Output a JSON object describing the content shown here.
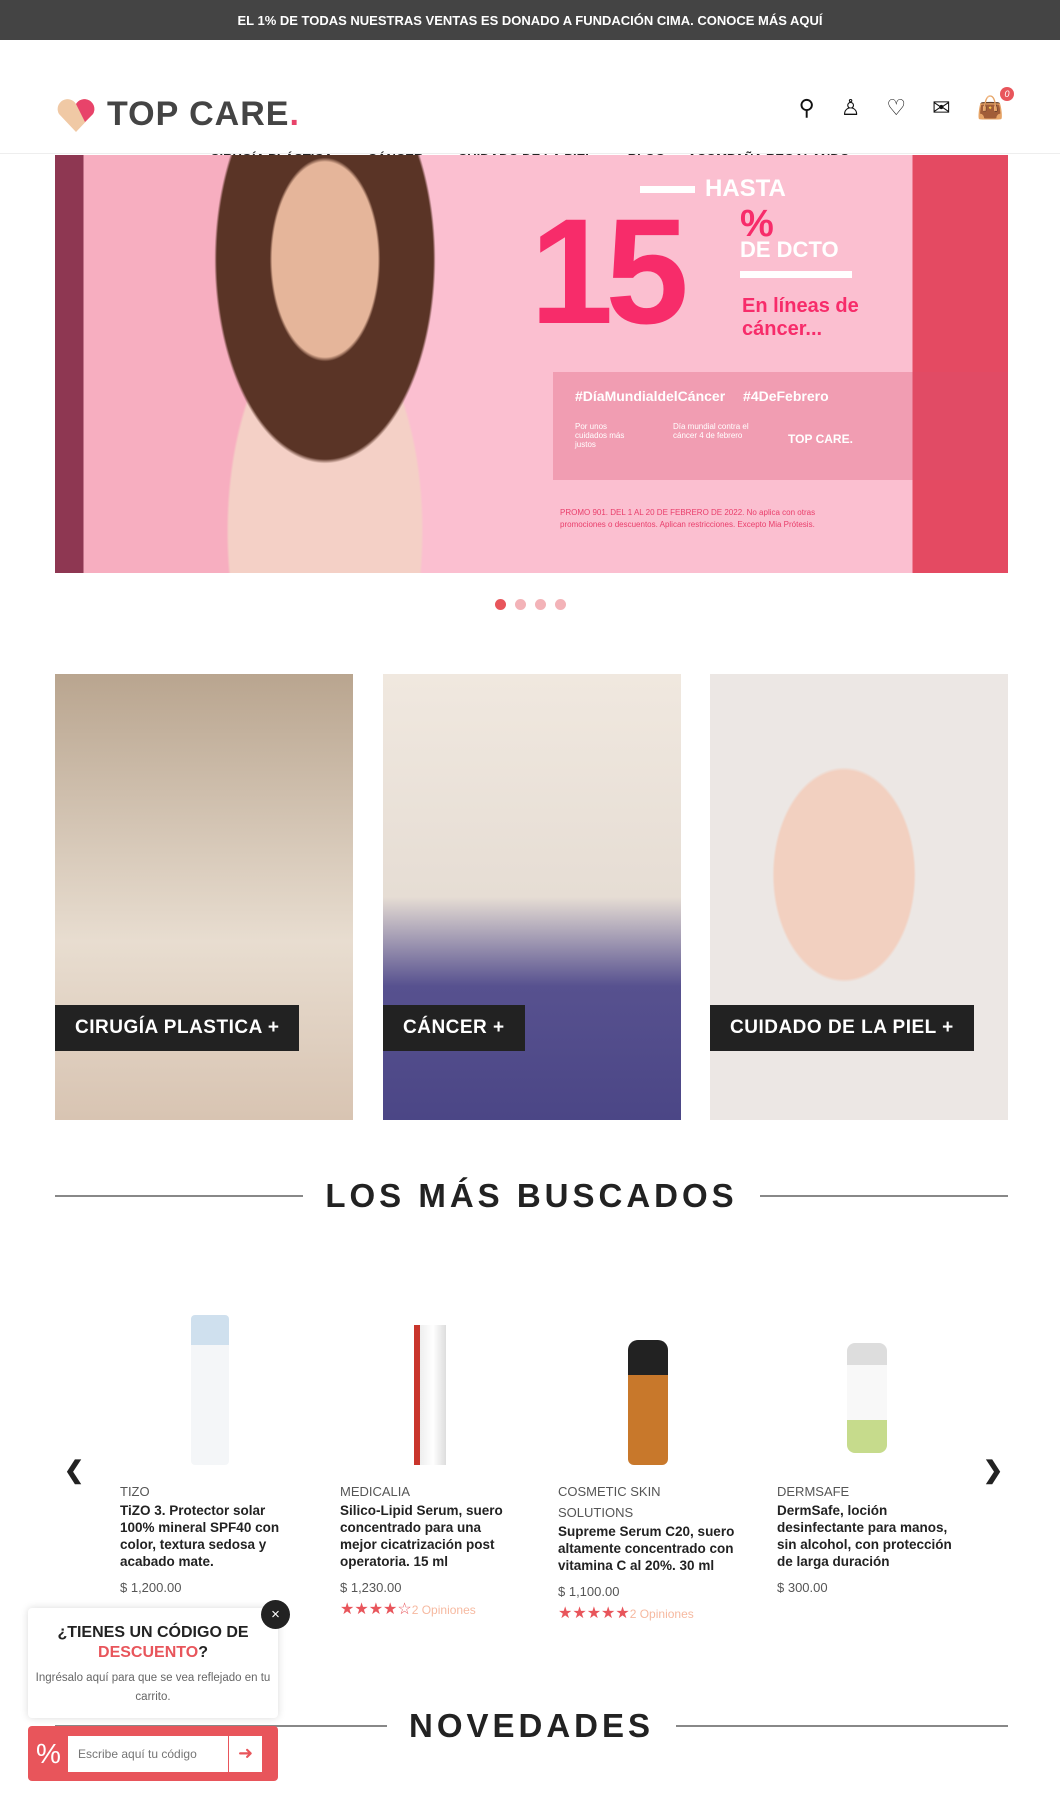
{
  "topbar": {
    "text": "EL 1% DE TODAS NUESTRAS VENTAS ES DONADO A FUNDACIÓN CIMA. CONOCE MÁS AQUÍ"
  },
  "header": {
    "logo": "TOP CARE",
    "logo_dot": ".",
    "cart_count": "0",
    "nav": [
      {
        "label": "CIRUGÍA PLÁSTICA",
        "dropdown": true
      },
      {
        "label": "CÁNCER",
        "dropdown": true
      },
      {
        "label": "CUIDADO DE LA PIEL",
        "dropdown": true
      },
      {
        "label": "BLOG"
      },
      {
        "label": "ACOMPAÑA REGALANDO"
      }
    ]
  },
  "banner": {
    "hasta": "HASTA",
    "number": "15",
    "percent": "%",
    "dcto": "DE DCTO",
    "lineas": "En líneas de cáncer...",
    "tags": "#DíaMundialdelCáncer #4DeFebrero",
    "small1": "Por unos cuidados más justos",
    "small2": "Día mundial contra el cáncer 4 de febrero",
    "logo": "TOP CARE.",
    "promo": "PROMO 901. DEL 1 AL 20 DE FEBRERO DE 2022. No aplica con otras promociones o descuentos. Aplican restricciones. Excepto Mia Prótesis.",
    "slides": 4,
    "active_slide": 1
  },
  "categories": [
    {
      "label": "CIRUGÍA PLASTICA  +"
    },
    {
      "label": "CÁNCER  +"
    },
    {
      "label": "CUIDADO DE LA PIEL  +"
    }
  ],
  "sections": {
    "buscados": "LOS MÁS BUSCADOS",
    "novedades": "NOVEDADES"
  },
  "products": [
    {
      "brand": "TIZO",
      "name": "TiZO 3. Protector solar 100% mineral SPF40 con color, textura sedosa y acabado mate.",
      "price": "$ 1,200.00"
    },
    {
      "brand": "MEDICALIA",
      "name": "Silico-Lipid Serum, suero concentrado para una mejor cicatrización post operatoria. 15 ml",
      "price": "$ 1,230.00",
      "stars": "★★★★☆",
      "reviews": "2 Opiniones"
    },
    {
      "brand": "COSMETIC SKIN SOLUTIONS",
      "name": "Supreme Serum C20, suero altamente concentrado con vitamina C al 20%. 30 ml",
      "price": "$ 1,100.00",
      "stars": "★★★★★",
      "reviews": "2 Opiniones"
    },
    {
      "brand": "DERMSAFE",
      "name": "DermSafe, loción desinfectante para manos, sin alcohol, con protección de larga duración",
      "price": "$ 300.00"
    }
  ],
  "popup": {
    "title1": "¿TIENES UN CÓDIGO DE",
    "title2": "DESCUENTO",
    "q": "?",
    "text": "Ingrésalo aquí para que se vea reflejado en tu carrito.",
    "placeholder": "Escribe aquí tu código",
    "close": "×",
    "percent": "%"
  }
}
